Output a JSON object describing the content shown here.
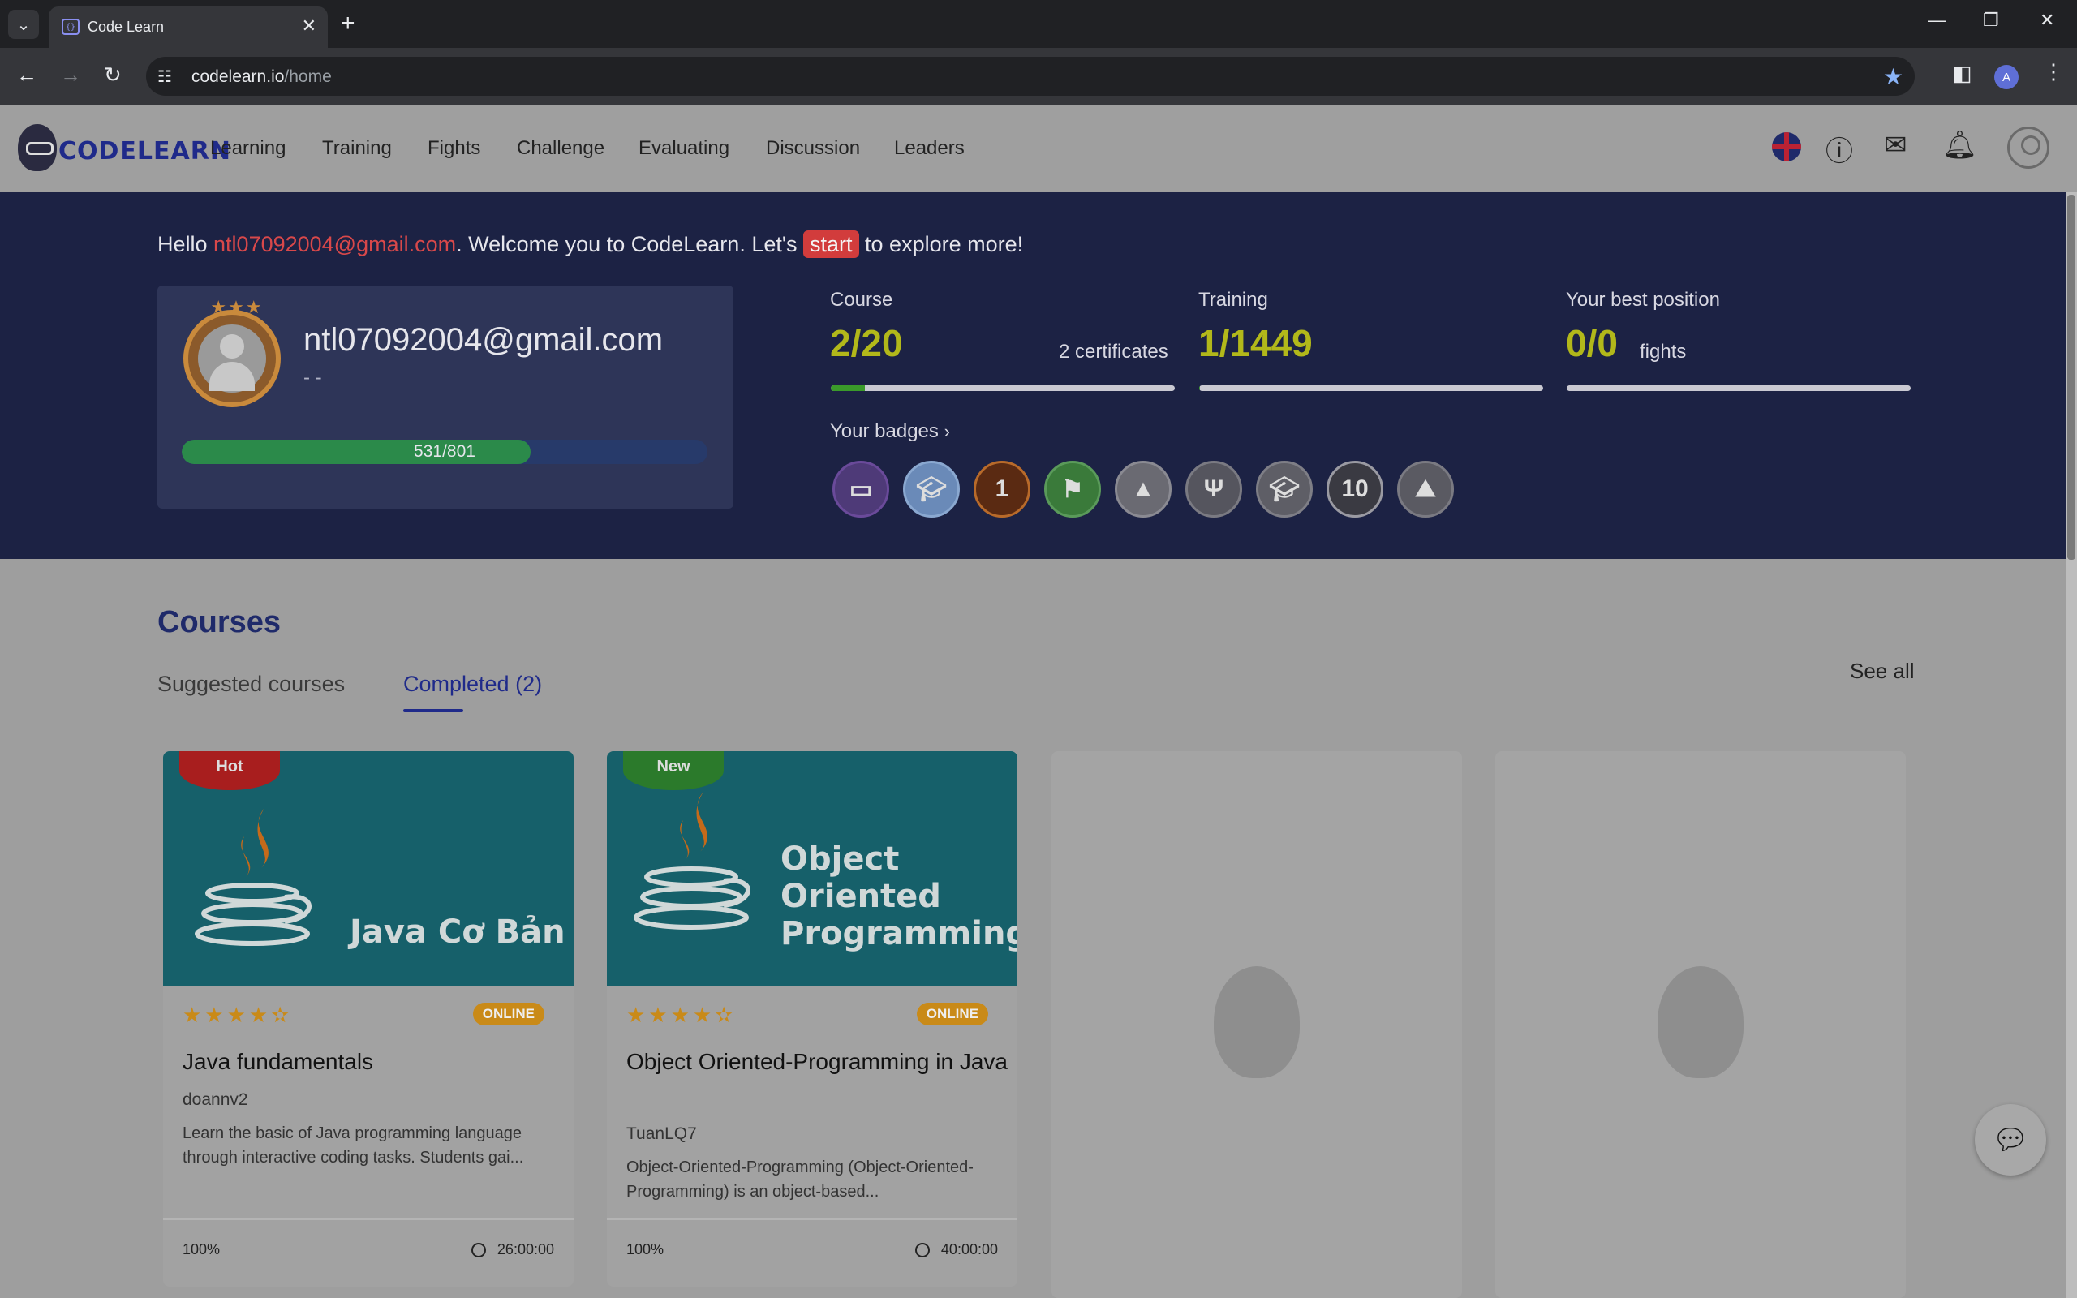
{
  "browser": {
    "tab_title": "Code Learn",
    "url_host": "codelearn.io",
    "url_path": "/home",
    "profile_initial": "A"
  },
  "header": {
    "logo": "CODELEARN",
    "nav": [
      "Learning",
      "Training",
      "Fights",
      "Challenge",
      "Evaluating",
      "Discussion",
      "Leaders"
    ]
  },
  "hero": {
    "hello_prefix": "Hello ",
    "email": "ntl07092004@gmail.com",
    "hello_mid": ". Welcome you to CodeLearn. Let's ",
    "start": "start",
    "hello_suffix": " to explore more!",
    "profile": {
      "email": "ntl07092004@gmail.com",
      "sub": "- -",
      "xp": "531/801",
      "xp_fraction": 0.663
    },
    "stats": {
      "course_label": "Course",
      "course_value": "2/20",
      "course_sub": "2 certificates",
      "course_fraction": 0.1,
      "training_label": "Training",
      "training_value": "1/1449",
      "training_fraction": 0.0007,
      "position_label": "Your best position",
      "position_value": "0/0",
      "position_sub": "fights",
      "position_fraction": 0
    },
    "badges_label": "Your badges",
    "badges": [
      "code-badge",
      "graduate-badge",
      "number-one-badge",
      "flag-badge",
      "mountain-badge",
      "laurel-badge",
      "cap-badge",
      "ten-badge",
      "summit-badge"
    ]
  },
  "courses": {
    "title": "Courses",
    "tab_suggested": "Suggested courses",
    "tab_completed": "Completed (2)",
    "see_all": "See all",
    "items": [
      {
        "ribbon": "Hot",
        "image_title": "Java Cơ Bản",
        "badge": "ONLINE",
        "title": "Java fundamentals",
        "author": "doannv2",
        "description": "Learn the basic of Java programming language through interactive coding tasks. Students gai...",
        "progress": "100%",
        "duration": "26:00:00",
        "rating": 4.5
      },
      {
        "ribbon": "New",
        "image_title": "Object Oriented Programming",
        "badge": "ONLINE",
        "title": "Object Oriented-Programming in Java",
        "author": "TuanLQ7",
        "description": "Object-Oriented-Programming (Object-Oriented-Programming) is an object-based...",
        "progress": "100%",
        "duration": "40:00:00",
        "rating": 4.5
      }
    ]
  },
  "colors": {
    "hero_bg": "#1c2244",
    "accent_yellow": "#b2b81a",
    "brand_blue": "#1f2a8a",
    "hot_ribbon": "#a81e1e",
    "new_ribbon": "#2b7a2b"
  }
}
